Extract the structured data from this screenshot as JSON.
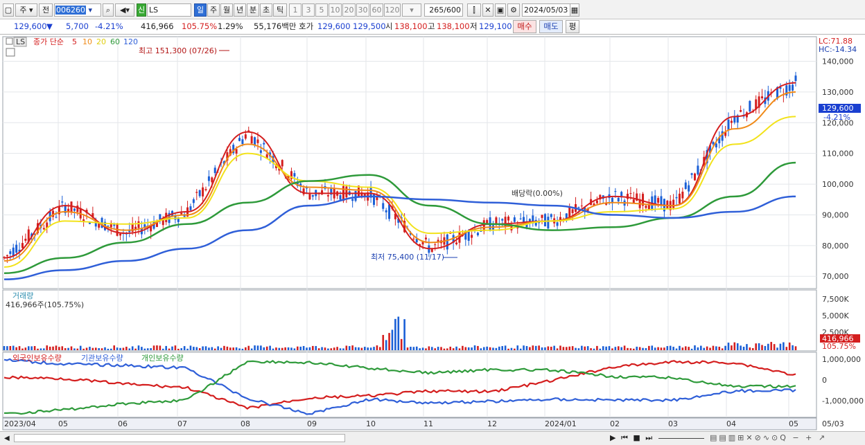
{
  "toolbar": {
    "period_label": "주",
    "prev_label": "전",
    "stock_code": "006260",
    "new_badge": "신",
    "stock_name": "LS",
    "periods": [
      "일",
      "주",
      "월",
      "년",
      "분",
      "초",
      "틱"
    ],
    "intervals": [
      "1",
      "3",
      "5",
      "10",
      "20",
      "30",
      "60",
      "120"
    ],
    "count": "265",
    "count_max": "/600",
    "date": "2024/05/03"
  },
  "quote": {
    "price": "129,600",
    "arrow": "▼",
    "change": "5,700",
    "change_pct": "-4.21%",
    "volume": "416,966",
    "volume_ratio": "105.75%",
    "turnover_pct": "1.29%",
    "amount": "55,176백만",
    "bid_label": "호가",
    "ask": "129,600",
    "bid": "129,500",
    "open_label": "시",
    "open": "138,100",
    "high_label": "고",
    "high": "138,100",
    "low_label": "저",
    "low": "129,100",
    "buy_label": "매수",
    "sell_label": "매도",
    "eval_label": "평"
  },
  "price_panel": {
    "ticker_tag": "LS",
    "legend_prefix": "종가 단순",
    "ma_labels": [
      "5",
      "10",
      "20",
      "60",
      "120"
    ],
    "ma_colors": [
      "#d41e1e",
      "#f08a18",
      "#f2e21a",
      "#2e9a3a",
      "#2f5fd8"
    ],
    "lc": "LC:71.88",
    "hc": "HC:-14.34",
    "high_note": "최고 151,300 (07/26)",
    "low_note": "최저 75,400 (11/17)",
    "dividend_note": "배당락(0.00%)",
    "last_price_tag": "129,600",
    "last_pct_tag": "-4.21%",
    "y_ticks": [
      "140,000",
      "130,000",
      "120,000",
      "110,000",
      "100,000",
      "90,000",
      "80,000",
      "70,000"
    ]
  },
  "volume_panel": {
    "title": "거래량",
    "value": "416,966주(105.75%)",
    "y_ticks": [
      "7,500K",
      "5,000K",
      "2,500K"
    ],
    "last_tag": "416,966",
    "last_pct": "105.75%"
  },
  "holding_panel": {
    "labels": [
      "외국인보유수량",
      "기관보유수량",
      "개인보유수량"
    ],
    "colors": [
      "#d41e1e",
      "#2f5fd8",
      "#2e9a3a"
    ],
    "y_ticks": [
      "1,000,000",
      "0",
      "-1,000,000"
    ]
  },
  "x_axis": [
    "2023/04",
    "05",
    "06",
    "07",
    "08",
    "09",
    "10",
    "11",
    "12",
    "2024/01",
    "02",
    "03",
    "04",
    "05",
    "05/03"
  ],
  "chart_data": {
    "type": "line",
    "title": "LS",
    "x": [
      "2023/04",
      "05",
      "06",
      "07",
      "08",
      "09",
      "10",
      "11",
      "12",
      "2024/01",
      "02",
      "03",
      "04",
      "05"
    ],
    "ylim": [
      66000,
      148000
    ],
    "series": [
      {
        "name": "5",
        "values": [
          76000,
          93000,
          84000,
          91000,
          117000,
          97000,
          97000,
          79000,
          87000,
          88000,
          96000,
          93000,
          122000,
          133000
        ]
      },
      {
        "name": "10",
        "values": [
          75000,
          91000,
          85000,
          90000,
          113000,
          99000,
          98000,
          81000,
          86000,
          88000,
          94000,
          93000,
          118000,
          130000
        ]
      },
      {
        "name": "20",
        "values": [
          73000,
          88000,
          87000,
          89000,
          110000,
          101000,
          99000,
          84000,
          85000,
          88000,
          91000,
          92000,
          113000,
          122000
        ]
      },
      {
        "name": "60",
        "values": [
          71000,
          76000,
          81000,
          87000,
          94000,
          101000,
          103000,
          93000,
          87000,
          85000,
          86000,
          89000,
          96000,
          107000
        ]
      },
      {
        "name": "120",
        "values": [
          69000,
          72000,
          75000,
          79000,
          85000,
          93000,
          96000,
          95000,
          94000,
          93000,
          90000,
          89000,
          91000,
          96000
        ]
      }
    ]
  }
}
